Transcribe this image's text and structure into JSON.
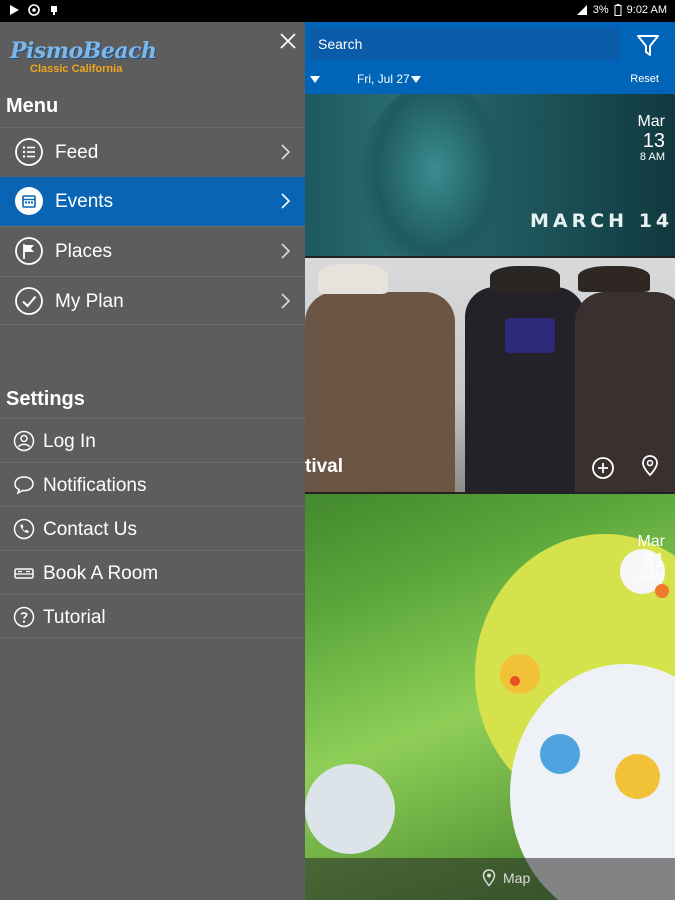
{
  "status_bar": {
    "battery_percent": "3%",
    "time": "9:02 AM",
    "left_icons": [
      "play-store-icon",
      "settings-gear-icon",
      "notification-icon"
    ],
    "right_icons": [
      "signal-icon",
      "battery-icon"
    ]
  },
  "drawer": {
    "logo": {
      "main": "PismoBeach",
      "sub": "Classic California"
    },
    "menu_title": "Menu",
    "menu_items": [
      {
        "label": "Feed",
        "icon": "list-icon",
        "active": false
      },
      {
        "label": "Events",
        "icon": "calendar-icon",
        "active": true
      },
      {
        "label": "Places",
        "icon": "flag-icon",
        "active": false
      },
      {
        "label": "My Plan",
        "icon": "checkmark-icon",
        "active": false
      }
    ],
    "settings_title": "Settings",
    "settings_items": [
      {
        "label": "Log In",
        "icon": "user-icon"
      },
      {
        "label": "Notifications",
        "icon": "chat-bubble-icon"
      },
      {
        "label": "Contact Us",
        "icon": "phone-icon"
      },
      {
        "label": "Book A Room",
        "icon": "bed-icon"
      },
      {
        "label": "Tutorial",
        "icon": "question-icon"
      }
    ]
  },
  "content": {
    "search_placeholder": "Search",
    "date_filter": "Fri, Jul 27",
    "reset_label": "Reset",
    "events": [
      {
        "month": "Mar",
        "day": "13",
        "time": "8 AM",
        "banner_text": "MARCH 14"
      },
      {
        "title_fragment": "tival"
      },
      {
        "month": "Mar",
        "day": "31",
        "time": "10 AM"
      }
    ],
    "bottom_bar": {
      "map_label": "Map"
    }
  },
  "colors": {
    "drawer_bg": "#5d5d5d",
    "accent_blue": "#0a64b4",
    "logo_blue": "#7fb6e3",
    "logo_orange": "#f0a51e"
  }
}
